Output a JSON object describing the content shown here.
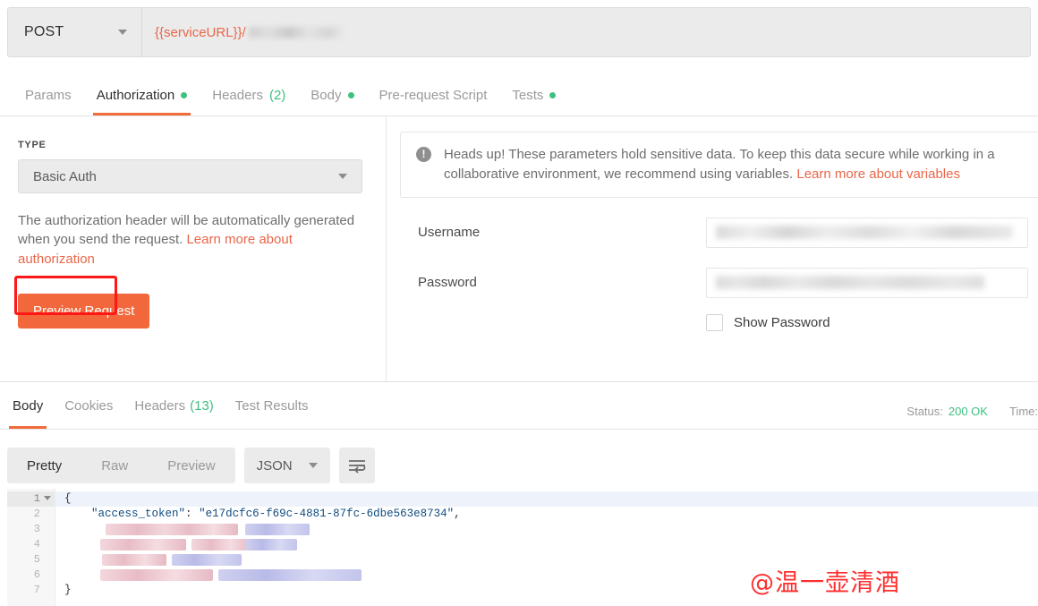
{
  "request_bar": {
    "method": "POST",
    "method_caret_icon": "chevron-down-icon",
    "url_variable": "{{serviceURL}}/",
    "url_redacted": true
  },
  "request_tabs": [
    {
      "label": "Params",
      "active": false,
      "dot": false,
      "count": ""
    },
    {
      "label": "Authorization",
      "active": true,
      "dot": true,
      "count": ""
    },
    {
      "label": "Headers",
      "active": false,
      "dot": false,
      "count": "(2)"
    },
    {
      "label": "Body",
      "active": false,
      "dot": true,
      "count": ""
    },
    {
      "label": "Pre-request Script",
      "active": false,
      "dot": false,
      "count": ""
    },
    {
      "label": "Tests",
      "active": false,
      "dot": true,
      "count": ""
    }
  ],
  "authorization": {
    "type_label": "TYPE",
    "type_value": "Basic Auth",
    "type_caret_icon": "chevron-down-icon",
    "annotation_highlight": "red-box-around-basic-auth",
    "description_text": "The authorization header will be automatically generated when you send the request. ",
    "description_link": "Learn more about authorization",
    "preview_button": "Preview Request",
    "notice_icon": "exclamation-circle-icon",
    "notice_text": "Heads up! These parameters hold sensitive data. To keep this data secure while working in a collaborative environment, we recommend using variables. ",
    "notice_link": "Learn more about variables",
    "username_label": "Username",
    "username_value": "",
    "password_label": "Password",
    "password_value": "",
    "show_password_label": "Show Password",
    "show_password_checked": false
  },
  "response_tabs": [
    {
      "label": "Body",
      "active": true,
      "count": ""
    },
    {
      "label": "Cookies",
      "active": false,
      "count": ""
    },
    {
      "label": "Headers",
      "active": false,
      "count": "(13)"
    },
    {
      "label": "Test Results",
      "active": false,
      "count": ""
    }
  ],
  "response_meta": {
    "status_label": "Status:",
    "status_value": "200 OK",
    "time_label": "Time:"
  },
  "response_toolbar": {
    "views": [
      {
        "label": "Pretty",
        "active": true
      },
      {
        "label": "Raw",
        "active": false
      },
      {
        "label": "Preview",
        "active": false
      }
    ],
    "format": "JSON",
    "format_caret_icon": "chevron-down-icon",
    "wrap_button_icon": "word-wrap-icon"
  },
  "response_body": {
    "line_numbers": [
      "1",
      "2",
      "3",
      "4",
      "5",
      "6",
      "7"
    ],
    "fold_icon": "fold-arrow-icon",
    "line1": "{",
    "line2_key": "\"access_token\"",
    "line2_colon": ": ",
    "line2_value": "\"e17dcfc6-f69c-4881-87fc-6dbe563e8734\"",
    "line2_comma": ",",
    "line7": "}",
    "redacted_lines": [
      3,
      4,
      5,
      6
    ]
  },
  "watermark": "@温一壶清酒",
  "colors": {
    "accent_orange": "#f26b3a",
    "status_green": "#3ec07f",
    "annotation_red": "#ff1616",
    "watermark_red": "#ff2d2d",
    "json_blue": "#0f4c81"
  }
}
